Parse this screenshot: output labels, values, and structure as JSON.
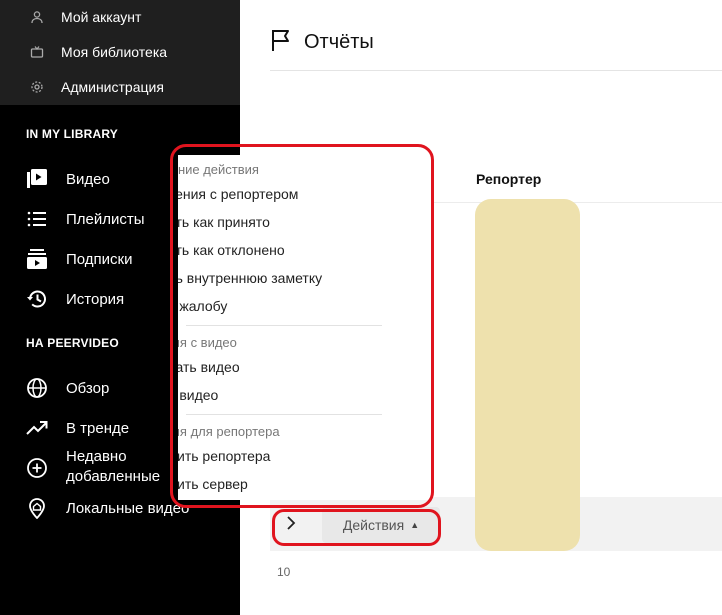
{
  "sidebar": {
    "account": [
      {
        "label": "Мой аккаунт",
        "icon": "user-icon"
      },
      {
        "label": "Моя библиотека",
        "icon": "tv-icon"
      },
      {
        "label": "Администрация",
        "icon": "gear-icon"
      }
    ],
    "library_title": "IN MY LIBRARY",
    "library": [
      {
        "label": "Видео",
        "icon": "video-icon"
      },
      {
        "label": "Плейлисты",
        "icon": "playlist-icon"
      },
      {
        "label": "Подписки",
        "icon": "subscriptions-icon"
      },
      {
        "label": "История",
        "icon": "history-icon"
      }
    ],
    "peervideo_title": "НА PEERVIDEO",
    "peervideo": [
      {
        "label": "Обзор",
        "icon": "globe-icon"
      },
      {
        "label": "В тренде",
        "icon": "trending-icon"
      },
      {
        "label": "Недавно добавленные",
        "icon": "plus-circle-icon"
      },
      {
        "label": "Локальные видео",
        "icon": "home-pin-icon"
      }
    ]
  },
  "header": {
    "title": "Отчёты",
    "icon": "flag-icon"
  },
  "table": {
    "column_reporter": "Репортер",
    "actions_label": "Действия",
    "page_count": "10"
  },
  "dropdown": {
    "sections": [
      {
        "header": "Внутренние действия",
        "items": [
          "Сообщения с репортером",
          "Отметить как принято",
          "Отметить как отклонено",
          "Добавить внутреннюю заметку",
          "Удалить жалобу"
        ]
      },
      {
        "header": "Действия с видео",
        "items": [
          "Заблокировать видео",
          "Удалить видео"
        ]
      },
      {
        "header": "Действия для репортера",
        "items": [
          "Исключить репортера",
          "Исключить сервер"
        ]
      }
    ]
  },
  "colors": {
    "sidebar": "#000000",
    "account_block": "#1f1f1f",
    "annotation": "#e0141e",
    "redaction": "#eee1ad"
  }
}
